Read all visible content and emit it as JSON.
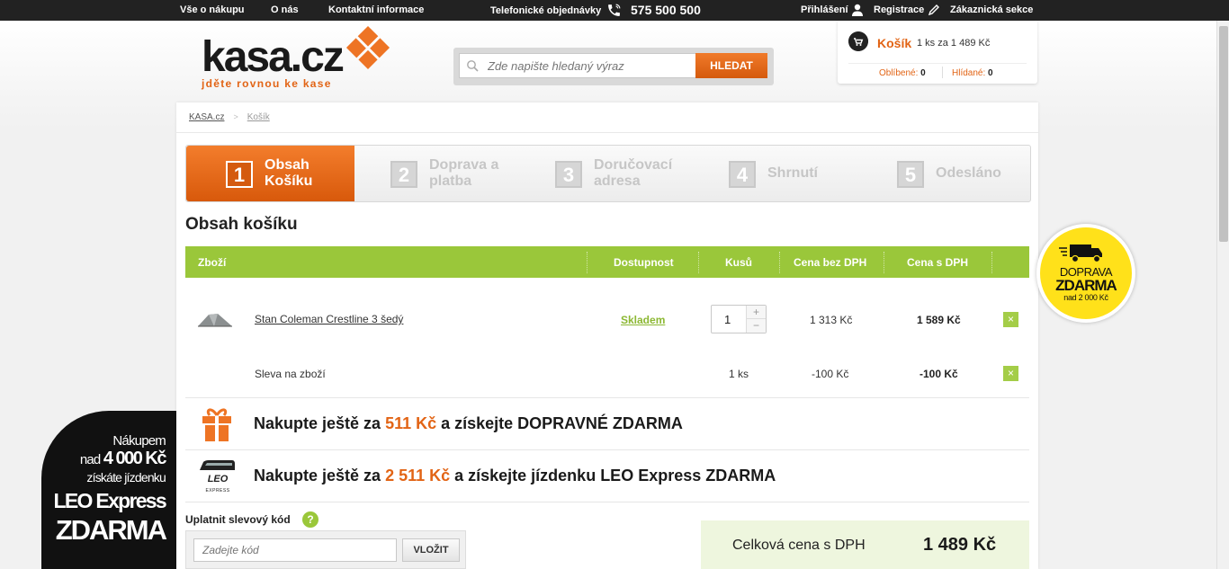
{
  "topbar": {
    "nav": [
      "Vše o nákupu",
      "O nás",
      "Kontaktní informace"
    ],
    "phone_label": "Telefonické objednávky",
    "phone_number": "575 500 500",
    "login": "Přihlášení",
    "register": "Registrace",
    "customer": "Zákaznická sekce"
  },
  "logo": {
    "word": "kasa.cz",
    "tagline": "jděte rovnou ke kase"
  },
  "search": {
    "placeholder": "Zde napište hledaný výraz",
    "button": "HLEDAT"
  },
  "cart": {
    "title": "Košík",
    "summary": "1 ks za 1 489 Kč",
    "favorites_label": "Oblíbené:",
    "favorites_count": "0",
    "watched_label": "Hlídané:",
    "watched_count": "0"
  },
  "breadcrumb": [
    "KASA.cz",
    "Košík"
  ],
  "steps": [
    {
      "num": "1",
      "label": "Obsah\nKošíku",
      "active": true
    },
    {
      "num": "2",
      "label": "Doprava a\nplatba",
      "active": false
    },
    {
      "num": "3",
      "label": "Doručovací\nadresa",
      "active": false
    },
    {
      "num": "4",
      "label": "Shrnutí",
      "active": false
    },
    {
      "num": "5",
      "label": "Odesláno",
      "active": false
    }
  ],
  "page_title": "Obsah košíku",
  "table": {
    "headers": [
      "Zboží",
      "Dostupnost",
      "Kusů",
      "Cena bez DPH",
      "Cena s DPH"
    ],
    "rows": [
      {
        "name": "Stan Coleman Crestline 3 šedý",
        "availability": "Skladem",
        "qty": "1",
        "price_ex": "1 313 Kč",
        "price_inc": "1 589 Kč"
      },
      {
        "name": "Sleva na zboží",
        "qty": "1 ks",
        "price_ex": "-100 Kč",
        "price_inc": "-100 Kč"
      }
    ]
  },
  "promos": [
    {
      "pre": "Nakupte ještě za ",
      "amount": "511 Kč",
      "post": " a získejte DOPRAVNÉ ZDARMA"
    },
    {
      "pre": "Nakupte ještě za ",
      "amount": "2 511 Kč",
      "post": " a získejte jízdenku LEO Express ZDARMA"
    }
  ],
  "coupon": {
    "label": "Uplatnit slevový kód",
    "help": "?",
    "placeholder": "Zadejte kód",
    "button": "VLOŽIT"
  },
  "total": {
    "label": "Celková cena s DPH",
    "value": "1 489 Kč"
  },
  "free_shipping_badge": {
    "line1": "DOPRAVA",
    "line2": "ZDARMA",
    "line3": "nad 2 000 Kč"
  },
  "leo_badge": {
    "line1": "Nákupem",
    "line2_pre": "nad ",
    "line2_amount": "4 000 Kč",
    "line3": "získáte jízdenku",
    "line4": "LEO Express",
    "line5": "ZDARMA"
  },
  "leo_logo": {
    "word": "LEO",
    "sub": "EXPRESS"
  },
  "colors": {
    "accent": "#e26415",
    "green": "#9ac73a",
    "yellow": "#ffe11a",
    "dark": "#222222"
  },
  "icons": [
    "phone-icon",
    "user-icon",
    "pencil-icon",
    "search-icon",
    "cart-icon",
    "gift-icon",
    "train-icon",
    "truck-icon",
    "close-icon",
    "help-icon"
  ]
}
